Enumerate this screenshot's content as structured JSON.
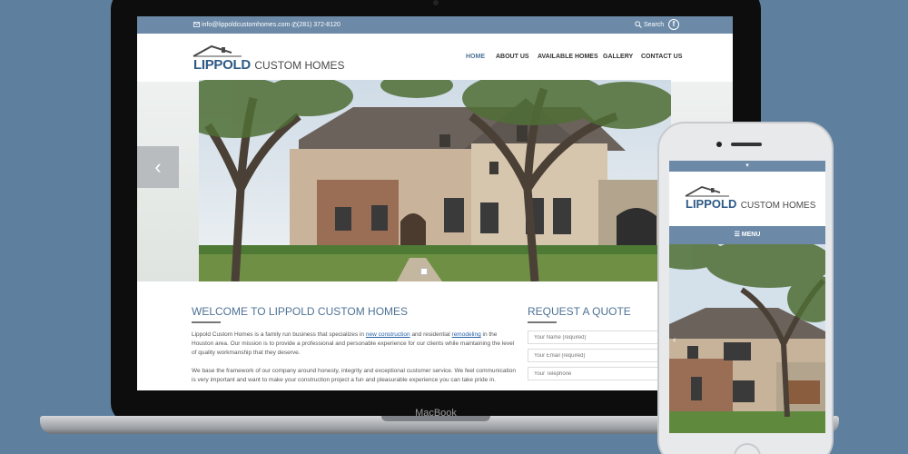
{
  "desktop": {
    "topbar": {
      "email": "info@lippoldcustomhomes.com",
      "phone": "(281) 372-8120",
      "search": "Search",
      "facebook": "f"
    },
    "logo": {
      "brand_bold": "LIPPOLD",
      "brand_rest": "CUSTOM HOMES"
    },
    "nav": [
      "HOME",
      "ABOUT US",
      "AVAILABLE HOMES",
      "GALLERY",
      "CONTACT US"
    ],
    "welcome": {
      "title": "WELCOME TO LIPPOLD CUSTOM HOMES",
      "p1_a": "Lippold Custom Homes is a family run business that specializes in",
      "p1_link1": "new construction",
      "p1_b": "and residential",
      "p1_link2": "remodeling",
      "p1_c": "in the Houston area. Our mission is to provide a professional and personable experience for our clients while maintaining the level of quality workmanship that they deserve.",
      "p2": "We base the framework of our company around honesty, integrity and exceptional customer service. We feel communication is very important and want to make your construction project a fun and pleasurable experience you can take pride in."
    },
    "quote": {
      "title": "REQUEST A QUOTE",
      "fields": [
        "Your Name (required)",
        "Your Email (required)",
        "Your Telephone"
      ]
    }
  },
  "device_label": "MacBook",
  "mobile": {
    "logo": {
      "brand_bold": "LIPPOLD",
      "brand_rest": "CUSTOM HOMES"
    },
    "menu": "MENU"
  },
  "colors": {
    "accent": "#6c8aa8",
    "brand_blue": "#2e5a86",
    "heading": "#4e7296",
    "background": "#5e7f9e"
  }
}
